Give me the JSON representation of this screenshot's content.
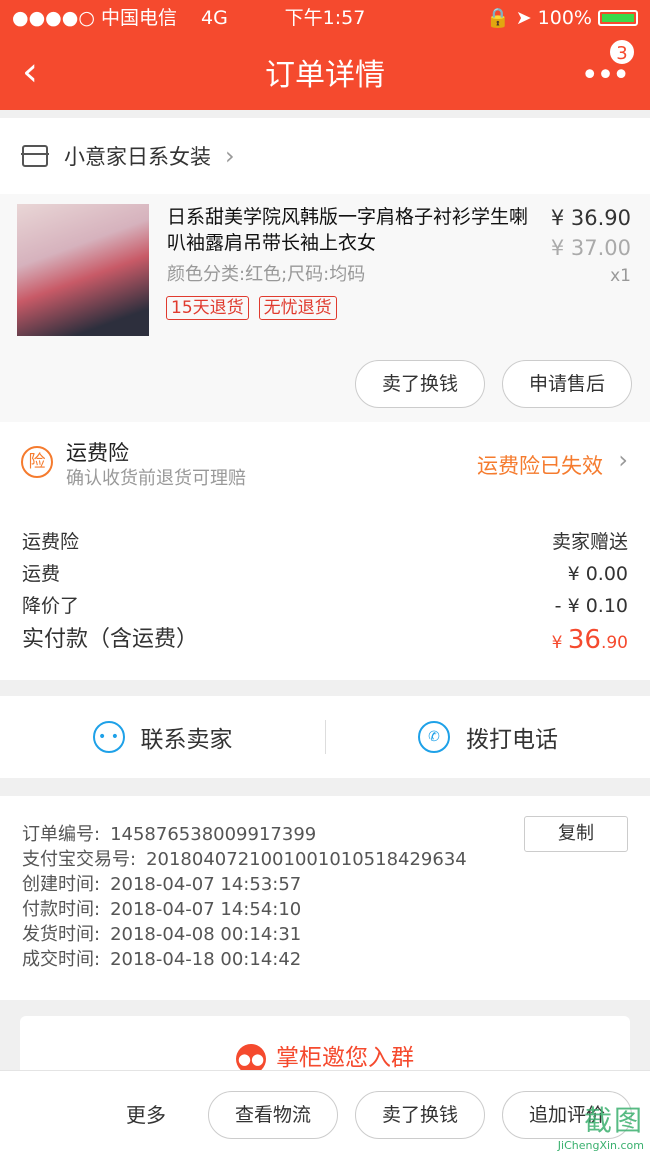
{
  "status_bar": {
    "signal": "●●●●○",
    "carrier": "中国电信",
    "network": "4G",
    "time": "下午1:57",
    "battery": "100%"
  },
  "navbar": {
    "title": "订单详情",
    "badge": "3"
  },
  "shop": {
    "name": "小意家日系女装"
  },
  "item": {
    "title": "日系甜美学院风韩版一字肩格子衬衫学生喇叭袖露肩吊带长袖上衣女",
    "spec": "颜色分类:红色;尺码:均码",
    "tags": [
      "15天退货",
      "无忧退货"
    ],
    "price": "¥ 36.90",
    "original_price": "¥ 37.00",
    "quantity": "x1",
    "actions": [
      "卖了换钱",
      "申请售后"
    ]
  },
  "insurance": {
    "icon_label": "险",
    "title": "运费险",
    "subtitle": "确认收货前退货可理赔",
    "status": "运费险已失效"
  },
  "fees": [
    {
      "label": "运费险",
      "value": "卖家赠送"
    },
    {
      "label": "运费",
      "value": "¥ 0.00"
    },
    {
      "label": "降价了",
      "value": "- ¥ 0.10"
    }
  ],
  "total": {
    "label": "实付款（含运费）",
    "currency": "¥ ",
    "integer": "36",
    "decimal": ".90"
  },
  "contact": {
    "seller": "联系卖家",
    "phone": "拨打电话"
  },
  "order_info": {
    "order_no_label": "订单编号:",
    "order_no": "145876538009917399",
    "copy_label": "复制",
    "alipay_label": "支付宝交易号:",
    "alipay_no": "2018040721001001010518429634",
    "created_label": "创建时间:",
    "created": "2018-04-07 14:53:57",
    "paid_label": "付款时间:",
    "paid": "2018-04-07 14:54:10",
    "shipped_label": "发货时间:",
    "shipped": "2018-04-08 00:14:31",
    "done_label": "成交时间:",
    "done": "2018-04-18 00:14:42"
  },
  "invite": {
    "label": "掌柜邀您入群"
  },
  "bottom_bar": {
    "more": "更多",
    "logistics": "查看物流",
    "resell": "卖了换钱",
    "review": "追加评价"
  },
  "watermark": {
    "text": "截图",
    "site": "JiChengXin.com"
  },
  "colors": {
    "brand": "#f54a2e",
    "insurance": "#f57b2e",
    "contact_icon": "#1ea1e8"
  }
}
